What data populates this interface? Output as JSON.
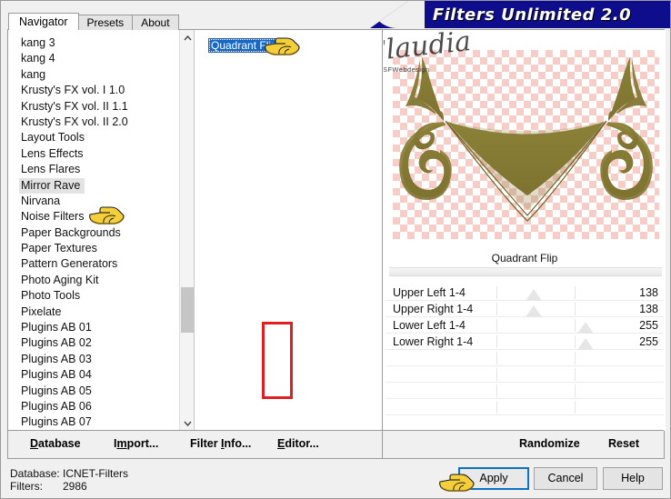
{
  "window": {
    "title": "Filters Unlimited 2.0"
  },
  "tabs": [
    {
      "label": "Navigator",
      "active": true
    },
    {
      "label": "Presets",
      "active": false
    },
    {
      "label": "About",
      "active": false
    }
  ],
  "navigator": {
    "items": [
      "kang 3",
      "kang 4",
      "kang",
      "Krusty's FX vol. I 1.0",
      "Krusty's FX vol. II 1.1",
      "Krusty's FX vol. II 2.0",
      "Layout Tools",
      "Lens Effects",
      "Lens Flares",
      "Mirror Rave",
      "Nirvana",
      "Noise Filters",
      "Paper Backgrounds",
      "Paper Textures",
      "Pattern Generators",
      "Photo Aging Kit",
      "Photo Tools",
      "Pixelate",
      "Plugins AB 01",
      "Plugins AB 02",
      "Plugins AB 03",
      "Plugins AB 04",
      "Plugins AB 05",
      "Plugins AB 06",
      "Plugins AB 07"
    ],
    "selected": "Mirror Rave",
    "scroll_up_icon": "chevron-up-icon",
    "scroll_down_icon": "chevron-down-icon"
  },
  "filter_tree": {
    "selected_item": "Quadrant Flip"
  },
  "params": {
    "title": "Quadrant Flip",
    "rows": [
      {
        "label": "Upper Left 1-4",
        "value": "138",
        "pos": 60
      },
      {
        "label": "Upper Right 1-4",
        "value": "138",
        "pos": 60
      },
      {
        "label": "Lower Left 1-4",
        "value": "255",
        "pos": 100
      },
      {
        "label": "Lower Right 1-4",
        "value": "255",
        "pos": 100
      },
      {
        "label": "",
        "value": "",
        "pos": null
      },
      {
        "label": "",
        "value": "",
        "pos": null
      },
      {
        "label": "",
        "value": "",
        "pos": null
      },
      {
        "label": "",
        "value": "",
        "pos": null
      }
    ],
    "highlight_color": "#e02020"
  },
  "watermark": {
    "signature": "Claudia",
    "subtext": "CGSFWebdesign"
  },
  "menubar": {
    "database": "Database",
    "import": "Import...",
    "filter_info": "Filter Info...",
    "editor": "Editor...",
    "randomize": "Randomize",
    "reset": "Reset"
  },
  "status": {
    "database_key": "Database:",
    "database_value": "ICNET-Filters",
    "filters_key": "Filters:",
    "filters_value": "2986"
  },
  "buttons": {
    "apply": "Apply",
    "cancel": "Cancel",
    "help": "Help"
  },
  "colors": {
    "title_bar": "#0e0e8c",
    "selection": "#1668c8",
    "artwork": "#847a35",
    "checker": "#f7cdc7",
    "accent": "#0b72c4"
  },
  "pointers": {
    "nav_hand": "pointing-hand-cursor",
    "tree_hand": "pointing-hand-cursor",
    "apply_hand": "pointing-hand-cursor"
  }
}
